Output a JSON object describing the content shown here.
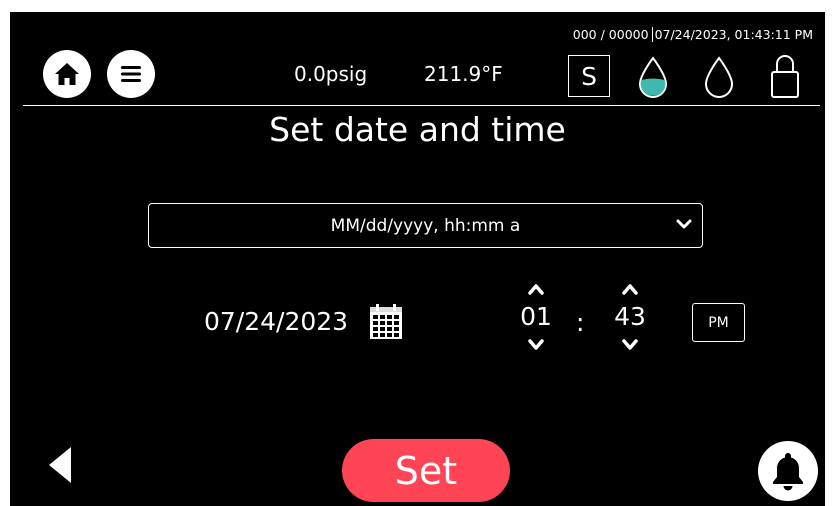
{
  "status": {
    "counter": "000 / 00000",
    "datetime": "07/24/2023, 01:43:11 PM"
  },
  "header": {
    "pressure": "0.0psig",
    "temperature": "211.9°F",
    "mode_letter": "S",
    "icons": [
      "home-icon",
      "menu-icon",
      "water-drop-filled-icon",
      "water-drop-outline-icon",
      "lock-icon"
    ],
    "accent_color": "#3fb8b0"
  },
  "page": {
    "title": "Set date and time"
  },
  "format_select": {
    "selected": "MM/dd/yyyy, hh:mm a"
  },
  "datetime_editor": {
    "date": "07/24/2023",
    "hour": "01",
    "separator": ":",
    "minute": "43",
    "meridiem": "PM"
  },
  "footer": {
    "set_label": "Set",
    "set_color": "#ff4455"
  }
}
